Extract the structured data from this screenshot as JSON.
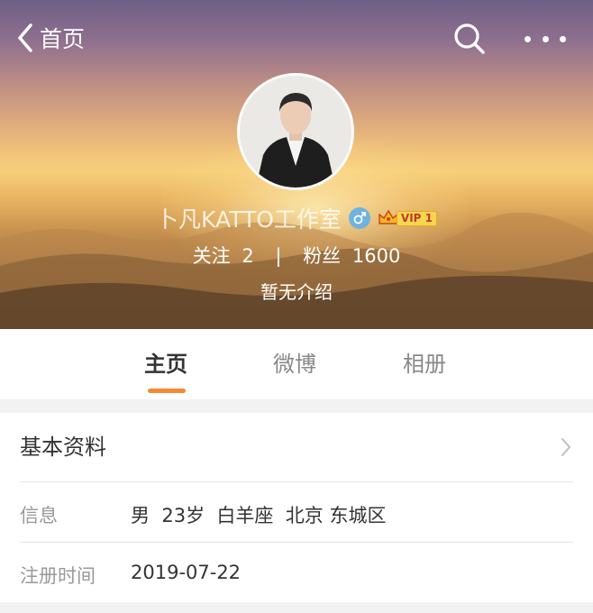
{
  "header": {
    "back_label": "首页",
    "icons": {
      "back": "chevron-left-icon",
      "search": "search-icon",
      "more": "more-dots-icon"
    }
  },
  "profile": {
    "nickname": "卜凡KATTO工作室",
    "gender_icon": "male-icon",
    "vip_label": "VIP 1",
    "following_label": "关注",
    "following_count": "2",
    "separator": "|",
    "followers_label": "粉丝",
    "followers_count": "1600",
    "bio": "暂无介绍"
  },
  "tabs": [
    {
      "label": "主页",
      "active": true
    },
    {
      "label": "微博",
      "active": false
    },
    {
      "label": "相册",
      "active": false
    }
  ],
  "basic_info": {
    "title": "基本资料",
    "rows": [
      {
        "label": "信息",
        "value": "男  23岁  白羊座  北京 东城区"
      },
      {
        "label": "注册时间",
        "value": "2019-07-22"
      }
    ]
  },
  "colors": {
    "accent": "#f28a33",
    "gender_badge": "#6fb3e0",
    "vip_badge": "#f7d64f"
  }
}
